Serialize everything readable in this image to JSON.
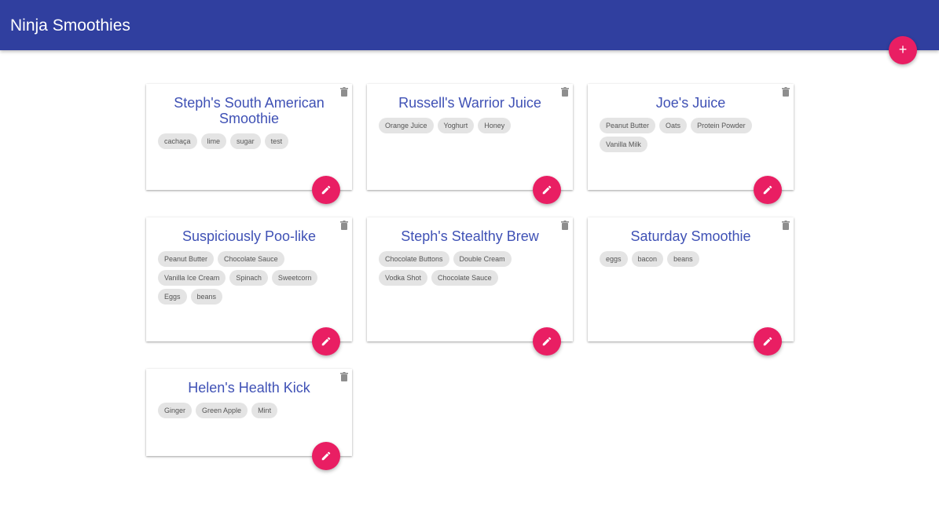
{
  "app": {
    "brand": "Ninja Smoothies",
    "add_button_label": "+"
  },
  "colors": {
    "navbar": "#303f9f",
    "title": "#3f51b5",
    "accent": "#e91e63",
    "chip": "#e4e4e4"
  },
  "icons": {
    "delete": "trash-icon",
    "edit": "pencil-icon",
    "add": "plus-icon"
  },
  "smoothies": [
    {
      "title": "Steph's South American Smoothie",
      "ingredients": [
        "cachaça",
        "lime",
        "sugar",
        "test"
      ]
    },
    {
      "title": "Russell's Warrior Juice",
      "ingredients": [
        "Orange Juice",
        "Yoghurt",
        "Honey"
      ]
    },
    {
      "title": "Joe's Juice",
      "ingredients": [
        "Peanut Butter",
        "Oats",
        "Protein Powder",
        "Vanilla Milk"
      ]
    },
    {
      "title": "Suspiciously Poo-like",
      "ingredients": [
        "Peanut Butter",
        "Chocolate Sauce",
        "Vanilla Ice Cream",
        "Spinach",
        "Sweetcorn",
        "Eggs",
        "beans"
      ]
    },
    {
      "title": "Steph's Stealthy Brew",
      "ingredients": [
        "Chocolate Buttons",
        "Double Cream",
        "Vodka Shot",
        "Chocolate Sauce"
      ]
    },
    {
      "title": "Saturday Smoothie",
      "ingredients": [
        "eggs",
        "bacon",
        "beans"
      ]
    },
    {
      "title": "Helen's Health Kick",
      "ingredients": [
        "Ginger",
        "Green Apple",
        "Mint"
      ]
    }
  ]
}
